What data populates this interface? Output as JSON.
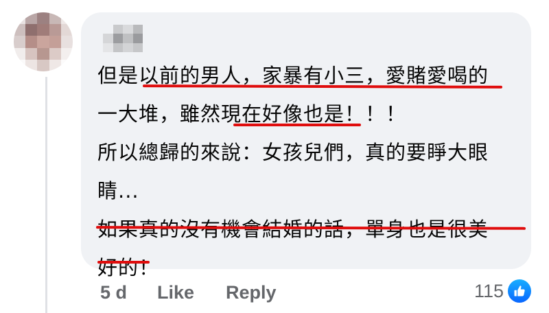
{
  "comment": {
    "lines": [
      "但是以前的男人，家暴有小三，愛賭愛喝的",
      "一大堆，雖然現在好像也是！！！",
      "所以總歸的來說：女孩兒們，真的要睜大眼",
      "睛...",
      "如果真的沒有機會結婚的話，單身也是很美",
      "好的！"
    ]
  },
  "footer": {
    "time": "5 d",
    "like_label": "Like",
    "reply_label": "Reply",
    "reaction_count": "115",
    "reaction_icon": "thumbs-up-icon"
  },
  "colors": {
    "bubble": "#f0f2f5",
    "text": "#050505",
    "meta": "#65676b",
    "annotation": "#e00d0d",
    "like_blue": "#0866ff"
  }
}
